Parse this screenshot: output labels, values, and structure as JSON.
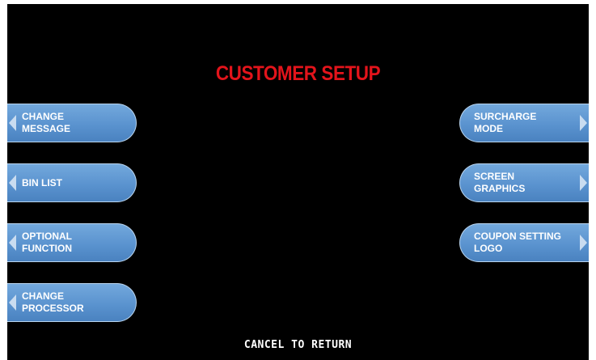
{
  "screen": {
    "title": "CUSTOMER SETUP",
    "footer": "CANCEL TO RETURN"
  },
  "left_buttons": [
    {
      "line1": "CHANGE",
      "line2": "MESSAGE"
    },
    {
      "line1": "BIN LIST",
      "line2": ""
    },
    {
      "line1": "OPTIONAL",
      "line2": "FUNCTION"
    },
    {
      "line1": "CHANGE",
      "line2": "PROCESSOR"
    }
  ],
  "right_buttons": [
    {
      "line1": "SURCHARGE",
      "line2": "MODE"
    },
    {
      "line1": "SCREEN",
      "line2": "GRAPHICS"
    },
    {
      "line1": "COUPON SETTING",
      "line2": "LOGO"
    }
  ],
  "colors": {
    "background": "#000000",
    "title": "#e3141b",
    "button": "#5a93cf",
    "button_text": "#ffffff"
  }
}
